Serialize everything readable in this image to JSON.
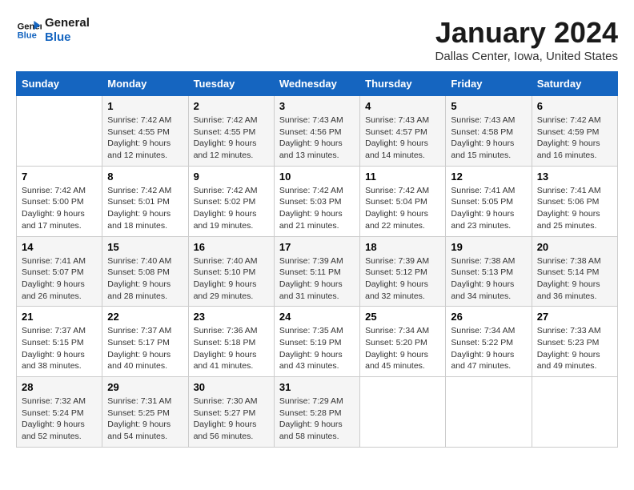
{
  "logo": {
    "line1": "General",
    "line2": "Blue"
  },
  "title": "January 2024",
  "subtitle": "Dallas Center, Iowa, United States",
  "days_of_week": [
    "Sunday",
    "Monday",
    "Tuesday",
    "Wednesday",
    "Thursday",
    "Friday",
    "Saturday"
  ],
  "weeks": [
    [
      {
        "day": "",
        "detail": ""
      },
      {
        "day": "1",
        "detail": "Sunrise: 7:42 AM\nSunset: 4:55 PM\nDaylight: 9 hours\nand 12 minutes."
      },
      {
        "day": "2",
        "detail": "Sunrise: 7:42 AM\nSunset: 4:55 PM\nDaylight: 9 hours\nand 12 minutes."
      },
      {
        "day": "3",
        "detail": "Sunrise: 7:43 AM\nSunset: 4:56 PM\nDaylight: 9 hours\nand 13 minutes."
      },
      {
        "day": "4",
        "detail": "Sunrise: 7:43 AM\nSunset: 4:57 PM\nDaylight: 9 hours\nand 14 minutes."
      },
      {
        "day": "5",
        "detail": "Sunrise: 7:43 AM\nSunset: 4:58 PM\nDaylight: 9 hours\nand 15 minutes."
      },
      {
        "day": "6",
        "detail": "Sunrise: 7:42 AM\nSunset: 4:59 PM\nDaylight: 9 hours\nand 16 minutes."
      }
    ],
    [
      {
        "day": "7",
        "detail": "Sunrise: 7:42 AM\nSunset: 5:00 PM\nDaylight: 9 hours\nand 17 minutes."
      },
      {
        "day": "8",
        "detail": "Sunrise: 7:42 AM\nSunset: 5:01 PM\nDaylight: 9 hours\nand 18 minutes."
      },
      {
        "day": "9",
        "detail": "Sunrise: 7:42 AM\nSunset: 5:02 PM\nDaylight: 9 hours\nand 19 minutes."
      },
      {
        "day": "10",
        "detail": "Sunrise: 7:42 AM\nSunset: 5:03 PM\nDaylight: 9 hours\nand 21 minutes."
      },
      {
        "day": "11",
        "detail": "Sunrise: 7:42 AM\nSunset: 5:04 PM\nDaylight: 9 hours\nand 22 minutes."
      },
      {
        "day": "12",
        "detail": "Sunrise: 7:41 AM\nSunset: 5:05 PM\nDaylight: 9 hours\nand 23 minutes."
      },
      {
        "day": "13",
        "detail": "Sunrise: 7:41 AM\nSunset: 5:06 PM\nDaylight: 9 hours\nand 25 minutes."
      }
    ],
    [
      {
        "day": "14",
        "detail": "Sunrise: 7:41 AM\nSunset: 5:07 PM\nDaylight: 9 hours\nand 26 minutes."
      },
      {
        "day": "15",
        "detail": "Sunrise: 7:40 AM\nSunset: 5:08 PM\nDaylight: 9 hours\nand 28 minutes."
      },
      {
        "day": "16",
        "detail": "Sunrise: 7:40 AM\nSunset: 5:10 PM\nDaylight: 9 hours\nand 29 minutes."
      },
      {
        "day": "17",
        "detail": "Sunrise: 7:39 AM\nSunset: 5:11 PM\nDaylight: 9 hours\nand 31 minutes."
      },
      {
        "day": "18",
        "detail": "Sunrise: 7:39 AM\nSunset: 5:12 PM\nDaylight: 9 hours\nand 32 minutes."
      },
      {
        "day": "19",
        "detail": "Sunrise: 7:38 AM\nSunset: 5:13 PM\nDaylight: 9 hours\nand 34 minutes."
      },
      {
        "day": "20",
        "detail": "Sunrise: 7:38 AM\nSunset: 5:14 PM\nDaylight: 9 hours\nand 36 minutes."
      }
    ],
    [
      {
        "day": "21",
        "detail": "Sunrise: 7:37 AM\nSunset: 5:15 PM\nDaylight: 9 hours\nand 38 minutes."
      },
      {
        "day": "22",
        "detail": "Sunrise: 7:37 AM\nSunset: 5:17 PM\nDaylight: 9 hours\nand 40 minutes."
      },
      {
        "day": "23",
        "detail": "Sunrise: 7:36 AM\nSunset: 5:18 PM\nDaylight: 9 hours\nand 41 minutes."
      },
      {
        "day": "24",
        "detail": "Sunrise: 7:35 AM\nSunset: 5:19 PM\nDaylight: 9 hours\nand 43 minutes."
      },
      {
        "day": "25",
        "detail": "Sunrise: 7:34 AM\nSunset: 5:20 PM\nDaylight: 9 hours\nand 45 minutes."
      },
      {
        "day": "26",
        "detail": "Sunrise: 7:34 AM\nSunset: 5:22 PM\nDaylight: 9 hours\nand 47 minutes."
      },
      {
        "day": "27",
        "detail": "Sunrise: 7:33 AM\nSunset: 5:23 PM\nDaylight: 9 hours\nand 49 minutes."
      }
    ],
    [
      {
        "day": "28",
        "detail": "Sunrise: 7:32 AM\nSunset: 5:24 PM\nDaylight: 9 hours\nand 52 minutes."
      },
      {
        "day": "29",
        "detail": "Sunrise: 7:31 AM\nSunset: 5:25 PM\nDaylight: 9 hours\nand 54 minutes."
      },
      {
        "day": "30",
        "detail": "Sunrise: 7:30 AM\nSunset: 5:27 PM\nDaylight: 9 hours\nand 56 minutes."
      },
      {
        "day": "31",
        "detail": "Sunrise: 7:29 AM\nSunset: 5:28 PM\nDaylight: 9 hours\nand 58 minutes."
      },
      {
        "day": "",
        "detail": ""
      },
      {
        "day": "",
        "detail": ""
      },
      {
        "day": "",
        "detail": ""
      }
    ]
  ]
}
